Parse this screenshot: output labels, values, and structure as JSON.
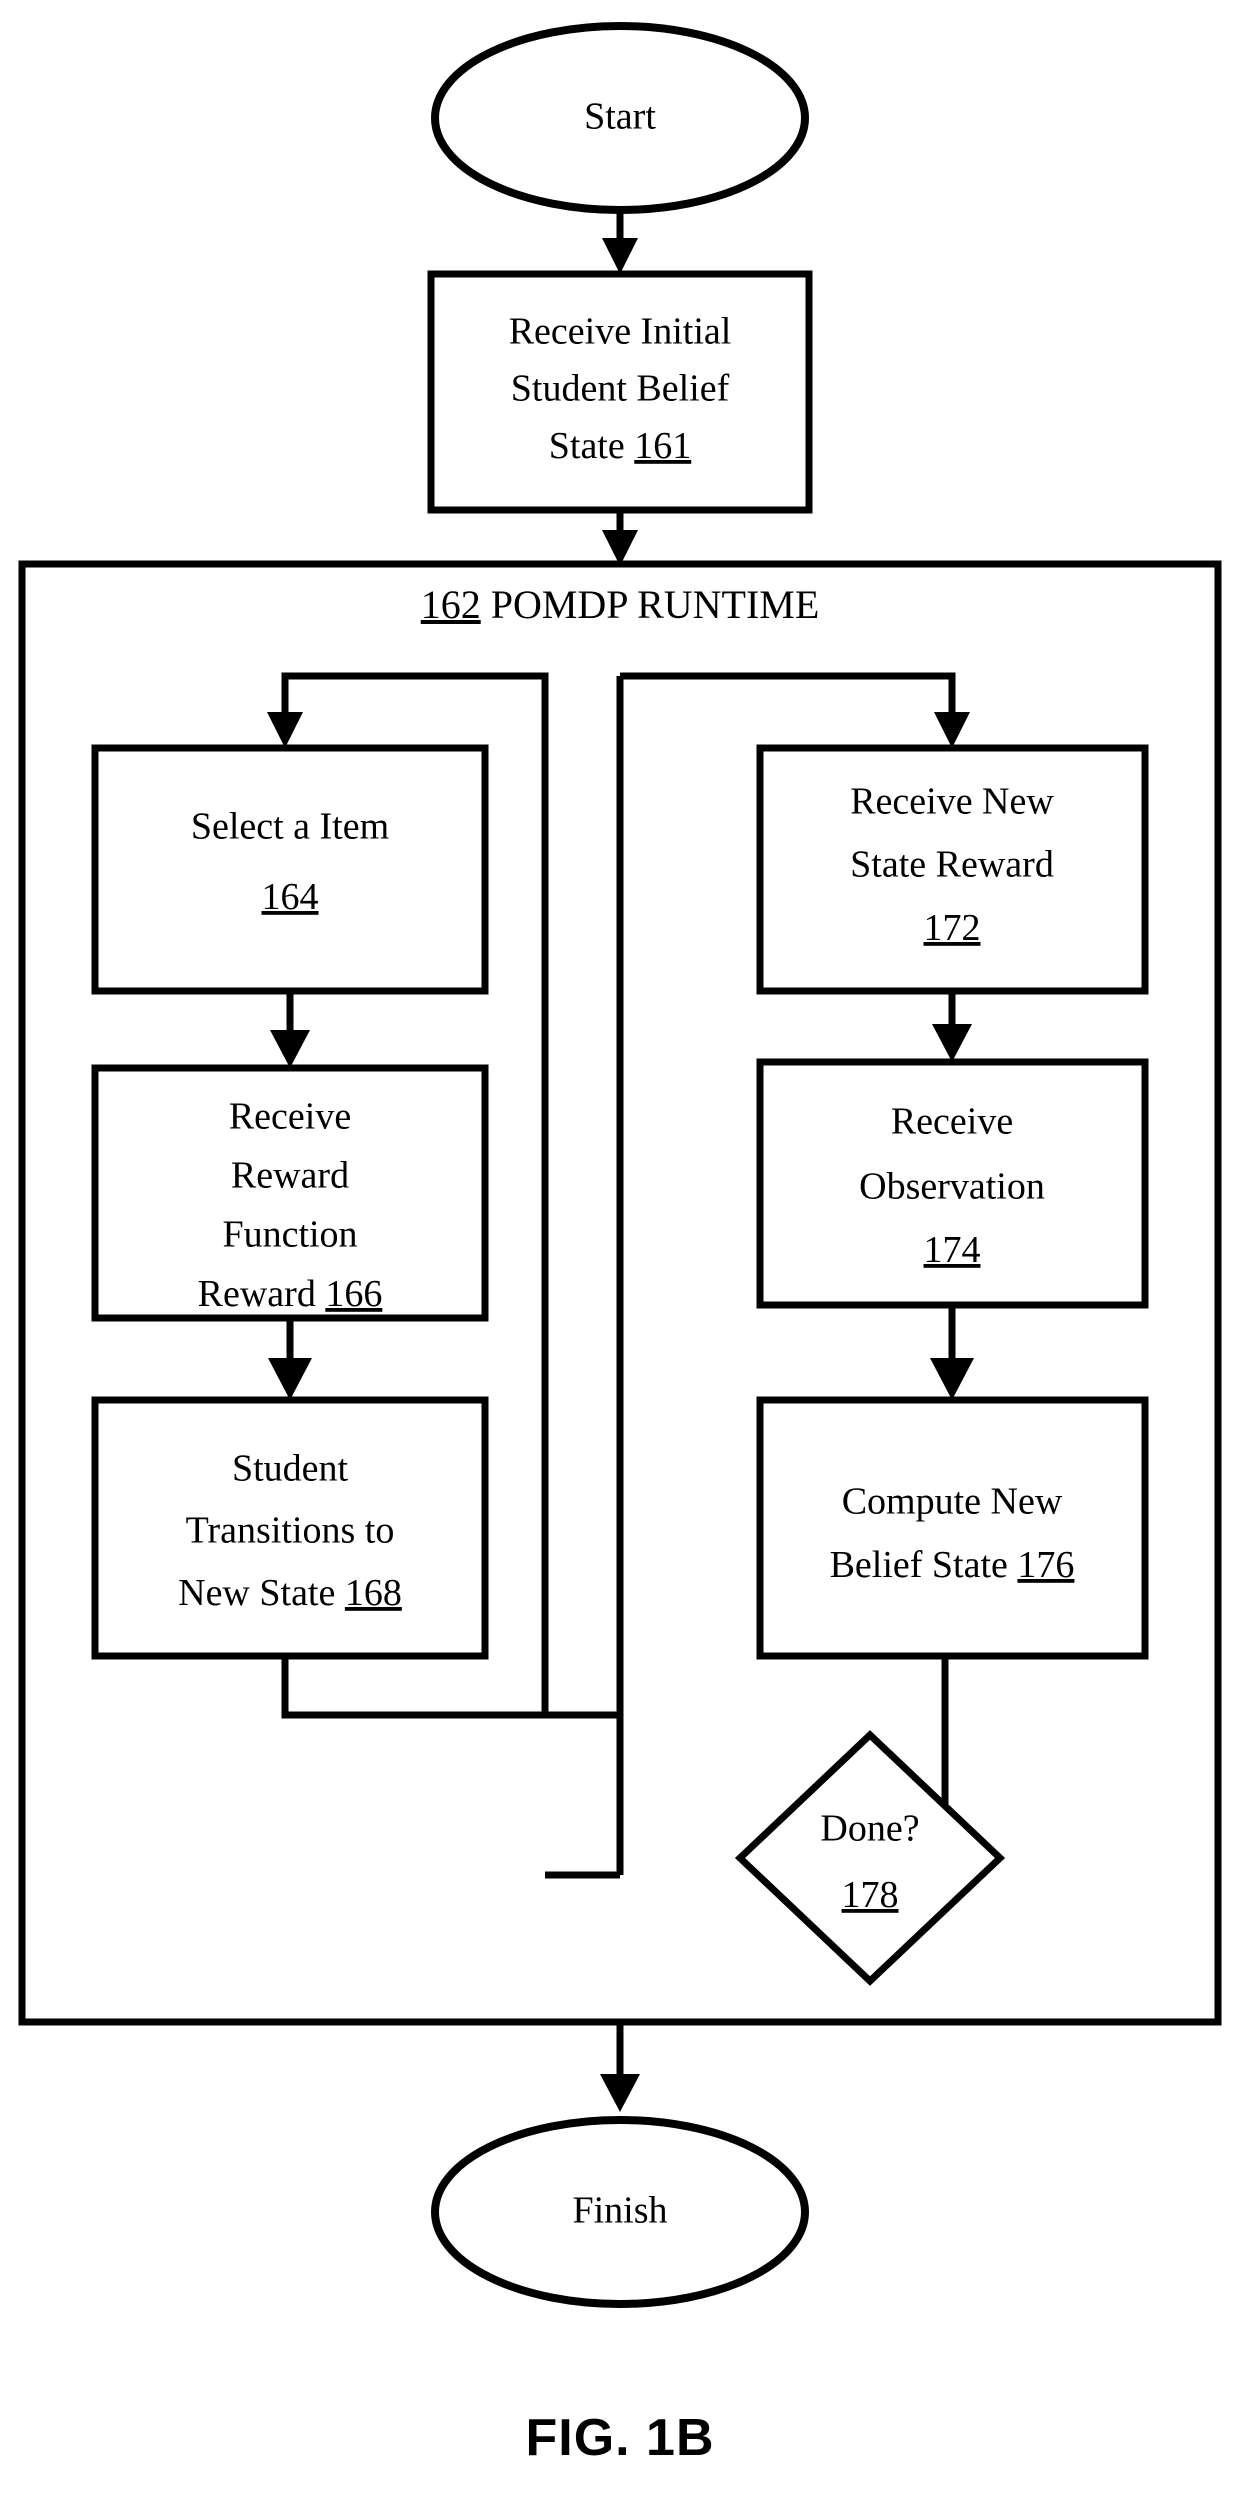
{
  "figure": {
    "caption": "FIG. 1B",
    "type": "flowchart"
  },
  "nodes": {
    "start": {
      "label": "Start",
      "shape": "ellipse"
    },
    "receive_initial_belief": {
      "lines": [
        "Receive Initial",
        "Student Belief",
        "State "
      ],
      "line1": "Receive Initial",
      "line2": "Student Belief",
      "line3": "State ",
      "ref": "161",
      "shape": "process"
    },
    "select_item": {
      "line1": "Select a Item",
      "ref": "164",
      "shape": "process"
    },
    "receive_reward_function": {
      "line1": "Receive",
      "line2": "Reward",
      "line3": "Function",
      "line4": "Reward ",
      "ref": "166",
      "shape": "process"
    },
    "student_transitions": {
      "line1": "Student",
      "line2": "Transitions to",
      "line3": "New State ",
      "ref": "168",
      "shape": "process"
    },
    "receive_new_state_reward": {
      "line1": "Receive New",
      "line2": "State Reward",
      "ref": "172",
      "shape": "process"
    },
    "receive_observation": {
      "line1": "Receive",
      "line2": "Observation",
      "ref": "174",
      "shape": "process"
    },
    "compute_new_belief_state": {
      "line1": "Compute New",
      "line2": "Belief State ",
      "ref": "176",
      "shape": "process"
    },
    "done_decision": {
      "line1": "Done?",
      "ref": "178",
      "shape": "diamond"
    },
    "finish": {
      "label": "Finish",
      "shape": "ellipse"
    }
  },
  "container": {
    "ref": "162",
    "title": " POMDP RUNTIME"
  },
  "colors": {
    "stroke": "#000000",
    "fill": "#ffffff",
    "text": "#000000"
  }
}
